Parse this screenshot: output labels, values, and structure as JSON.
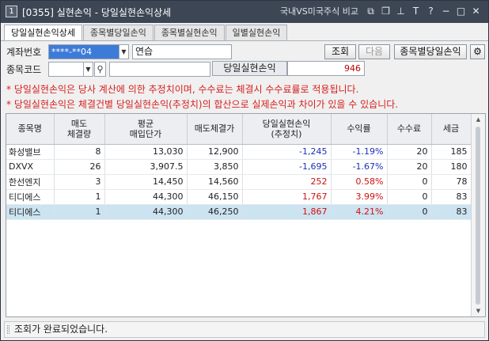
{
  "window": {
    "number": "1",
    "title": "[0355] 실현손익 - 당일실현손익상세",
    "compare_label": "국내VS미국주식 비교"
  },
  "title_buttons": [
    "restore-icon",
    "copy-icon",
    "pin-icon",
    "font-icon",
    "help-icon",
    "minimize-icon",
    "maximize-icon",
    "close-icon"
  ],
  "title_glyphs": [
    "⧉",
    "❐",
    "⊥",
    "T",
    "?",
    "−",
    "□",
    "✕"
  ],
  "tabs": [
    {
      "label": "당일실현손익상세",
      "active": true
    },
    {
      "label": "종목별당일손익",
      "active": false
    },
    {
      "label": "종목별실현손익",
      "active": false
    },
    {
      "label": "일별실현손익",
      "active": false
    }
  ],
  "form": {
    "account_label": "계좌번호",
    "account_value": "****-**04",
    "account_name": "연습",
    "stock_code_label": "종목코드",
    "stock_code_value": "",
    "stock_name_value": "",
    "pl_label": "당일실현손익",
    "pl_value": "946"
  },
  "buttons": {
    "search": "조회",
    "next": "다음",
    "by_stock": "종목별당일손익"
  },
  "notices": [
    "* 당일실현손익은 당사 계산에 의한 추정치이며, 수수료는 체결시 수수료률로 적용됩니다.",
    "* 당일실현손익은 체결건별 당일실현손익(추정치)의 합산으로 실제손익과 차이가 있을 수 있습니다."
  ],
  "table": {
    "headers": [
      "종목명",
      "매도\n체결량",
      "평균\n매입단가",
      "매도체결가",
      "당일실현손익\n(추정치)",
      "수익률",
      "수수료",
      "세금"
    ],
    "rows": [
      [
        "화성밸브",
        "8",
        "13,030",
        "12,900",
        "-1,245",
        "-1.19%",
        "20",
        "185"
      ],
      [
        "DXVX",
        "26",
        "3,907.5",
        "3,850",
        "-1,695",
        "-1.67%",
        "20",
        "180"
      ],
      [
        "한선엔지",
        "3",
        "14,450",
        "14,560",
        "252",
        "0.58%",
        "0",
        "78"
      ],
      [
        "티디에스",
        "1",
        "44,300",
        "46,150",
        "1,767",
        "3.99%",
        "0",
        "83"
      ],
      [
        "티디에스",
        "1",
        "44,300",
        "46,250",
        "1,867",
        "4.21%",
        "0",
        "83"
      ]
    ],
    "selected_row": 4
  },
  "status": "조회가 완료되었습니다."
}
